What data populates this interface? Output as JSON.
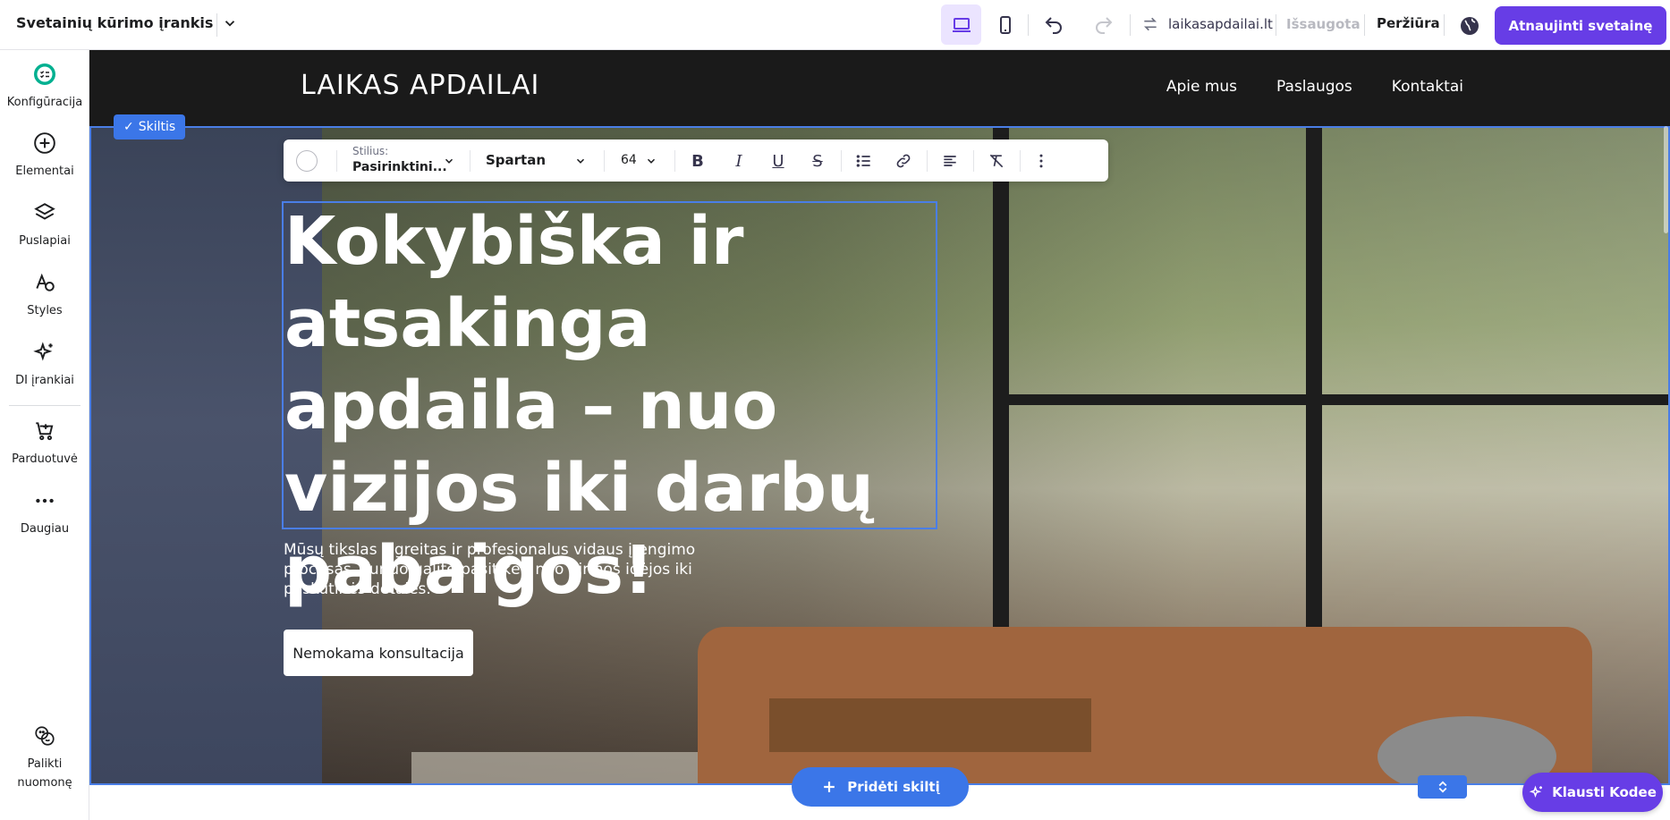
{
  "app": {
    "title": "Svetainių kūrimo įrankis",
    "domain": "laikasapdailai.lt",
    "saved_label": "Išsaugota",
    "preview_label": "Peržiūra",
    "update_label": "Atnaujinti svetainę",
    "accent_color": "#673de6",
    "selection_color": "#3b76e8"
  },
  "sidebar": {
    "items": [
      {
        "label": "Konfigūracija",
        "icon": "checklist-icon"
      },
      {
        "label": "Elementai",
        "icon": "plus-circle-icon"
      },
      {
        "label": "Puslapiai",
        "icon": "layers-icon"
      },
      {
        "label": "Styles",
        "icon": "styles-icon"
      },
      {
        "label": "DI įrankiai",
        "icon": "sparkles-icon"
      },
      {
        "label": "Parduotuvė",
        "icon": "cart-icon"
      },
      {
        "label": "Daugiau",
        "icon": "more-icon"
      }
    ],
    "feedback_label": "Palikti nuomonę"
  },
  "site": {
    "logo": "LAIKAS APDAILAI",
    "nav": [
      "Apie mus",
      "Paslaugos",
      "Kontaktai"
    ]
  },
  "section": {
    "tag_label": "Skiltis"
  },
  "text_toolbar": {
    "style_label": "Stilius:",
    "style_value": "Pasirinktini...",
    "font": "Spartan",
    "size": "64"
  },
  "hero": {
    "heading": "Kokybiška ir atsakinga apdaila – nuo vizijos iki darbų pabaigos!",
    "subtext": "Mūsų tikslas – greitas ir profesionalus vidaus įrengimo procesas, kuriuo galite pasitikėti nuo pirmos idėjos iki paskutinės detalės.",
    "cta": "Nemokama konsultacija"
  },
  "add_section_label": "Pridėti skiltį",
  "assistant_label": "Klausti Kodee"
}
